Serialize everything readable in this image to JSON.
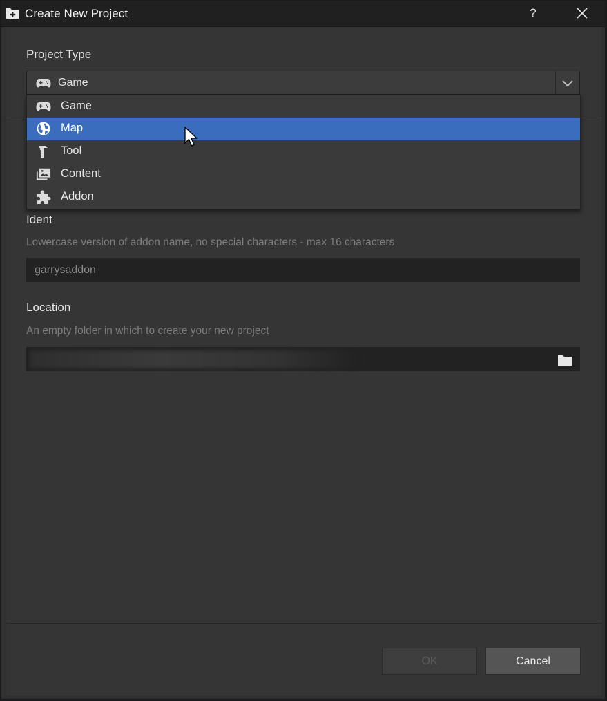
{
  "window": {
    "title": "Create New Project",
    "help_label": "?"
  },
  "project_type": {
    "label": "Project Type",
    "selected_value": "Game",
    "selected_icon": "gamepad-icon",
    "options": [
      {
        "label": "Game",
        "icon": "gamepad-icon",
        "highlighted": false
      },
      {
        "label": "Map",
        "icon": "globe-icon",
        "highlighted": true
      },
      {
        "label": "Tool",
        "icon": "hammer-icon",
        "highlighted": false
      },
      {
        "label": "Content",
        "icon": "images-icon",
        "highlighted": false
      },
      {
        "label": "Addon",
        "icon": "puzzle-icon",
        "highlighted": false
      }
    ]
  },
  "ident": {
    "label": "Ident",
    "hint": "Lowercase version of addon name, no special characters - max 16 characters",
    "value": "garrysaddon"
  },
  "location": {
    "label": "Location",
    "hint": "An empty folder in which to create your new project",
    "value": ""
  },
  "buttons": {
    "ok_label": "OK",
    "ok_enabled": false,
    "cancel_label": "Cancel"
  },
  "colors": {
    "highlight": "#3a6dbd",
    "background": "#353535",
    "titlebar": "#202020"
  }
}
